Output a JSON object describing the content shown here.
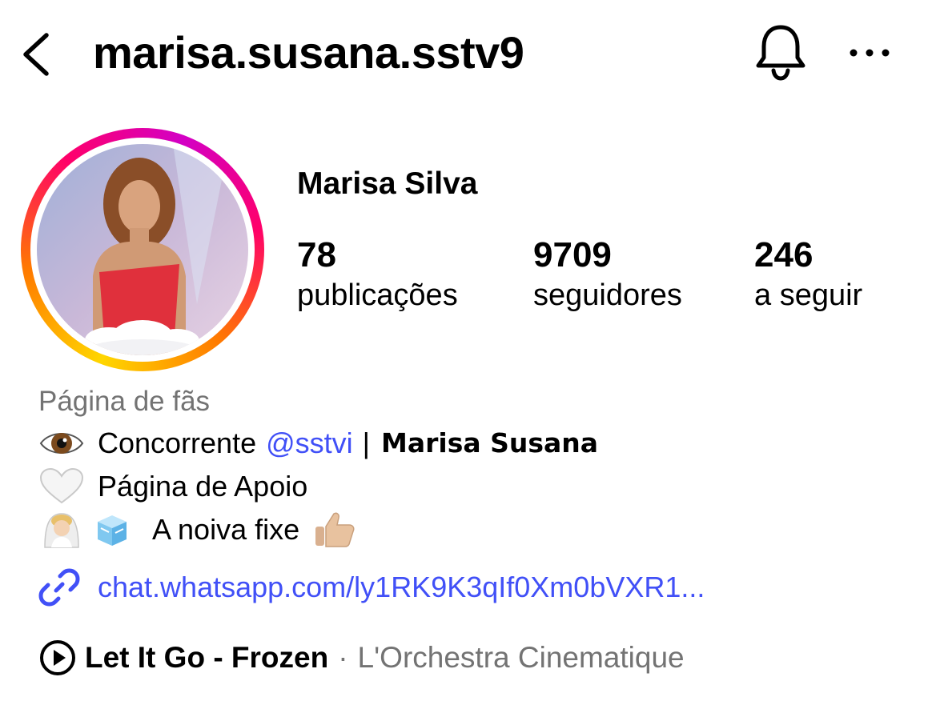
{
  "header": {
    "username": "marisa.susana.sstv9",
    "back_icon": "chevron-left-icon",
    "bell_icon": "bell-icon",
    "more_icon": "more-horizontal-icon"
  },
  "profile": {
    "display_name": "Marisa Silva",
    "avatar_ring_colors": [
      "#ffd600",
      "#ff7a00",
      "#ff0069",
      "#d300c5"
    ],
    "stats": [
      {
        "count": "78",
        "label": "publicações"
      },
      {
        "count": "9709",
        "label": "seguidores"
      },
      {
        "count": "246",
        "label": "a seguir"
      }
    ]
  },
  "bio": {
    "category": "Página de fãs",
    "line1": {
      "emoji": "eye-emoji",
      "prefix": "Concorrente",
      "mention": "@sstvi",
      "separator": "|",
      "bold": "Marisa Susana"
    },
    "line2": {
      "emoji": "white-heart-emoji",
      "text": "Página de Apoio"
    },
    "line3": {
      "emojis": [
        "bride-emoji",
        "ice-cube-emoji"
      ],
      "text": "A noiva fixe",
      "end_emoji": "thumbs-up-emoji"
    },
    "link": {
      "icon": "link-icon",
      "text": "chat.whatsapp.com/ly1RK9K3qIf0Xm0bVXR1..."
    }
  },
  "music": {
    "icon": "play-circle-icon",
    "song": "Let It Go - Frozen",
    "separator": "·",
    "artist": "L'Orchestra Cinematique"
  },
  "colors": {
    "link": "#4150f7",
    "secondary_text": "#737373"
  }
}
